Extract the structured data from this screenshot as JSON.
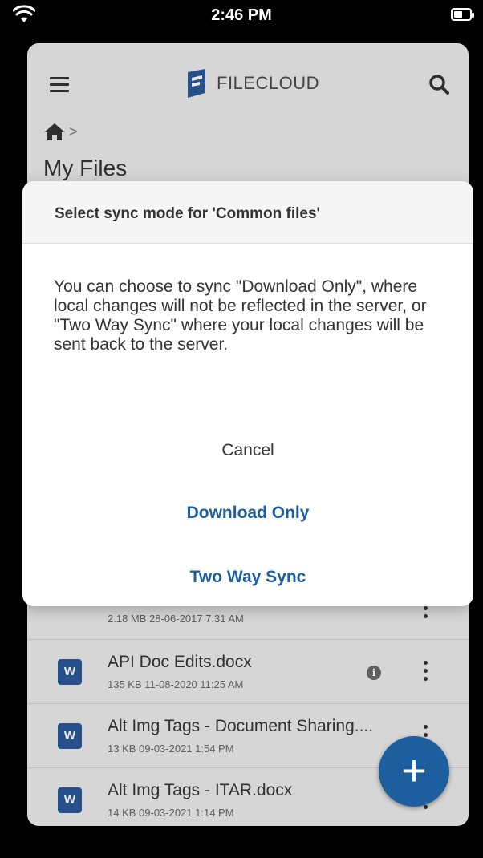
{
  "status_bar": {
    "time": "2:46 PM"
  },
  "app": {
    "logo_text": "FILECLOUD",
    "breadcrumb_sep": ">",
    "page_title": "My Files",
    "files": [
      {
        "name": "",
        "meta": "2.18 MB 28-06-2017 7:31 AM",
        "type": "image"
      },
      {
        "name": "API Doc Edits.docx",
        "meta": "135 KB 11-08-2020 11:25 AM",
        "type": "word",
        "icon_label": "W"
      },
      {
        "name": "Alt Img Tags - Document Sharing....",
        "meta": "13 KB 09-03-2021 1:54 PM",
        "type": "word",
        "icon_label": "W"
      },
      {
        "name": "Alt Img Tags - ITAR.docx",
        "meta": "14 KB 09-03-2021 1:14 PM",
        "type": "word",
        "icon_label": "W"
      }
    ],
    "fab_label": "+",
    "info_glyph": "i"
  },
  "dialog": {
    "title": "Select sync mode for 'Common files'",
    "body": "You can choose to sync \"Download Only\", where local changes will not be reflected in the server, or \"Two Way Sync\" where your local changes will be sent back to the server.",
    "cancel_label": "Cancel",
    "download_only_label": "Download Only",
    "two_way_label": "Two Way Sync"
  },
  "colors": {
    "accent": "#1d5f9e",
    "word_icon": "#2b5797"
  }
}
